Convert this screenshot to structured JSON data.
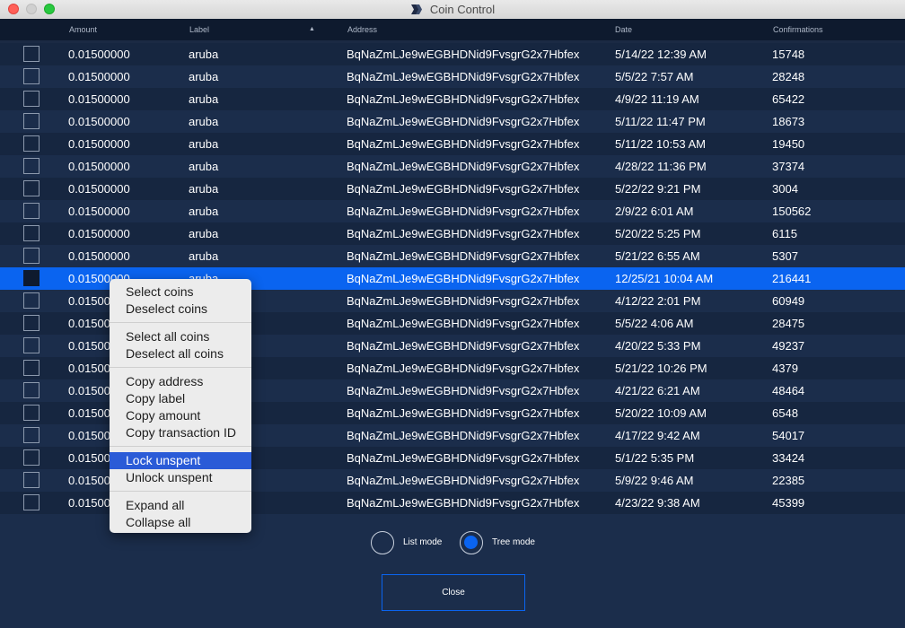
{
  "window": {
    "title": "Coin Control"
  },
  "table": {
    "columns": [
      "Amount",
      "Label",
      "Address",
      "Date",
      "Confirmations"
    ],
    "rows": [
      {
        "amount": "0.01500000",
        "label": "aruba",
        "address": "BqNaZmLJe9wEGBHDNid9FvsgrG2x7Hbfex",
        "date": "5/14/22 12:39 AM",
        "confirmations": "15748"
      },
      {
        "amount": "0.01500000",
        "label": "aruba",
        "address": "BqNaZmLJe9wEGBHDNid9FvsgrG2x7Hbfex",
        "date": "5/5/22 7:57 AM",
        "confirmations": "28248"
      },
      {
        "amount": "0.01500000",
        "label": "aruba",
        "address": "BqNaZmLJe9wEGBHDNid9FvsgrG2x7Hbfex",
        "date": "4/9/22 11:19 AM",
        "confirmations": "65422"
      },
      {
        "amount": "0.01500000",
        "label": "aruba",
        "address": "BqNaZmLJe9wEGBHDNid9FvsgrG2x7Hbfex",
        "date": "5/11/22 11:47 PM",
        "confirmations": "18673"
      },
      {
        "amount": "0.01500000",
        "label": "aruba",
        "address": "BqNaZmLJe9wEGBHDNid9FvsgrG2x7Hbfex",
        "date": "5/11/22 10:53 AM",
        "confirmations": "19450"
      },
      {
        "amount": "0.01500000",
        "label": "aruba",
        "address": "BqNaZmLJe9wEGBHDNid9FvsgrG2x7Hbfex",
        "date": "4/28/22 11:36 PM",
        "confirmations": "37374"
      },
      {
        "amount": "0.01500000",
        "label": "aruba",
        "address": "BqNaZmLJe9wEGBHDNid9FvsgrG2x7Hbfex",
        "date": "5/22/22 9:21 PM",
        "confirmations": "3004"
      },
      {
        "amount": "0.01500000",
        "label": "aruba",
        "address": "BqNaZmLJe9wEGBHDNid9FvsgrG2x7Hbfex",
        "date": "2/9/22 6:01 AM",
        "confirmations": "150562"
      },
      {
        "amount": "0.01500000",
        "label": "aruba",
        "address": "BqNaZmLJe9wEGBHDNid9FvsgrG2x7Hbfex",
        "date": "5/20/22 5:25 PM",
        "confirmations": "6115"
      },
      {
        "amount": "0.01500000",
        "label": "aruba",
        "address": "BqNaZmLJe9wEGBHDNid9FvsgrG2x7Hbfex",
        "date": "5/21/22 6:55 AM",
        "confirmations": "5307"
      },
      {
        "amount": "0.01500000",
        "label": "aruba",
        "address": "BqNaZmLJe9wEGBHDNid9FvsgrG2x7Hbfex",
        "date": "12/25/21 10:04 AM",
        "confirmations": "216441",
        "selected": true
      },
      {
        "amount": "0.01500",
        "label": "",
        "address": "BqNaZmLJe9wEGBHDNid9FvsgrG2x7Hbfex",
        "date": "4/12/22 2:01 PM",
        "confirmations": "60949"
      },
      {
        "amount": "0.01500",
        "label": "",
        "address": "BqNaZmLJe9wEGBHDNid9FvsgrG2x7Hbfex",
        "date": "5/5/22 4:06 AM",
        "confirmations": "28475"
      },
      {
        "amount": "0.01500",
        "label": "",
        "address": "BqNaZmLJe9wEGBHDNid9FvsgrG2x7Hbfex",
        "date": "4/20/22 5:33 PM",
        "confirmations": "49237"
      },
      {
        "amount": "0.01500",
        "label": "",
        "address": "BqNaZmLJe9wEGBHDNid9FvsgrG2x7Hbfex",
        "date": "5/21/22 10:26 PM",
        "confirmations": "4379"
      },
      {
        "amount": "0.01500",
        "label": "",
        "address": "BqNaZmLJe9wEGBHDNid9FvsgrG2x7Hbfex",
        "date": "4/21/22 6:21 AM",
        "confirmations": "48464"
      },
      {
        "amount": "0.01500",
        "label": "",
        "address": "BqNaZmLJe9wEGBHDNid9FvsgrG2x7Hbfex",
        "date": "5/20/22 10:09 AM",
        "confirmations": "6548"
      },
      {
        "amount": "0.01500",
        "label": "",
        "address": "BqNaZmLJe9wEGBHDNid9FvsgrG2x7Hbfex",
        "date": "4/17/22 9:42 AM",
        "confirmations": "54017"
      },
      {
        "amount": "0.01500",
        "label": "",
        "address": "BqNaZmLJe9wEGBHDNid9FvsgrG2x7Hbfex",
        "date": "5/1/22 5:35 PM",
        "confirmations": "33424"
      },
      {
        "amount": "0.01500",
        "label": "",
        "address": "BqNaZmLJe9wEGBHDNid9FvsgrG2x7Hbfex",
        "date": "5/9/22 9:46 AM",
        "confirmations": "22385"
      },
      {
        "amount": "0.01500",
        "label": "",
        "address": "BqNaZmLJe9wEGBHDNid9FvsgrG2x7Hbfex",
        "date": "4/23/22 9:38 AM",
        "confirmations": "45399"
      }
    ]
  },
  "context_menu": {
    "groups": [
      [
        {
          "label": "Select coins"
        },
        {
          "label": "Deselect coins"
        }
      ],
      [
        {
          "label": "Select all coins"
        },
        {
          "label": "Deselect all coins"
        }
      ],
      [
        {
          "label": "Copy address"
        },
        {
          "label": "Copy label"
        },
        {
          "label": "Copy amount"
        },
        {
          "label": "Copy transaction ID"
        }
      ],
      [
        {
          "label": "Lock unspent",
          "highlighted": true
        },
        {
          "label": "Unlock unspent"
        }
      ],
      [
        {
          "label": "Expand all"
        },
        {
          "label": "Collapse all"
        }
      ]
    ]
  },
  "modes": {
    "list_label": "List mode",
    "tree_label": "Tree mode",
    "selected": "tree"
  },
  "close_button": {
    "label": "Close"
  },
  "colors": {
    "accent": "#0a64f0",
    "background": "#1b2a44",
    "header": "#0e1a2e",
    "menu_highlight": "#2a5bd7"
  },
  "icons": {
    "sort": "sort-ascending-icon",
    "app": "app-logo-icon"
  }
}
